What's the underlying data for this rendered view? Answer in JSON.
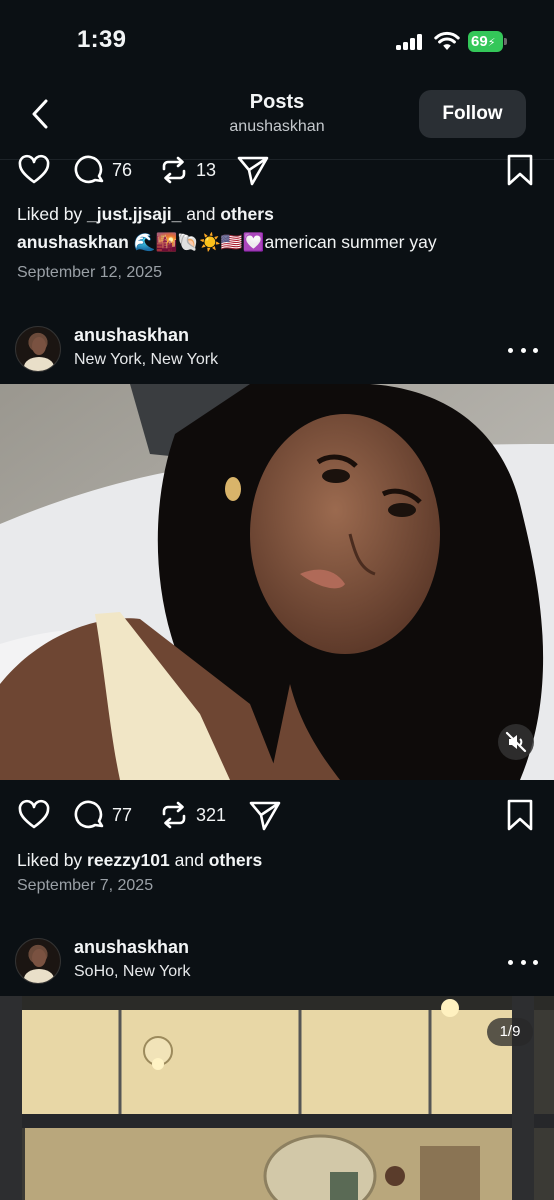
{
  "status_bar": {
    "time": "1:39",
    "battery": "69"
  },
  "nav": {
    "title": "Posts",
    "subtitle": "anushaskhan",
    "follow_label": "Follow"
  },
  "post1": {
    "comments": "76",
    "reposts": "13",
    "liked_prefix": "Liked by ",
    "liked_user": "_just.jjsaji_",
    "liked_and": " and ",
    "liked_others": "others",
    "caption_user": "anushaskhan",
    "caption_text": " 🌊🌇🐚☀️🇺🇸💟american summer yay",
    "date": "September 12, 2025"
  },
  "post2": {
    "username": "anushaskhan",
    "location": "New York, New York",
    "comments": "77",
    "reposts": "321",
    "liked_prefix": "Liked by ",
    "liked_user": "reezzy101",
    "liked_and": " and ",
    "liked_others": "others",
    "date": "September 7, 2025"
  },
  "post3": {
    "username": "anushaskhan",
    "location": "SoHo, New York",
    "carousel_counter": "1/9"
  },
  "icons": {
    "back": "chevron-left-icon",
    "like": "heart-icon",
    "comment": "comment-icon",
    "repost": "repost-icon",
    "share": "send-icon",
    "save": "bookmark-icon",
    "more": "more-dots-icon",
    "mute": "speaker-muted-icon"
  },
  "colors": {
    "background": "#0b1014",
    "battery_green": "#34c759",
    "muted_text": "#9aa0a6",
    "button_bg": "#2a2f34"
  }
}
